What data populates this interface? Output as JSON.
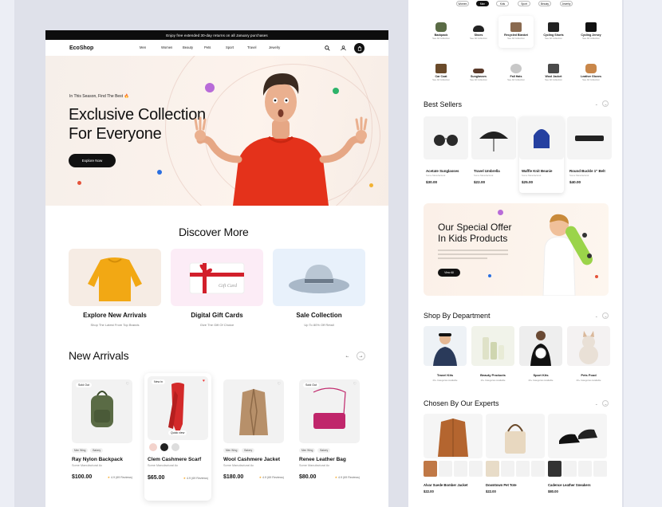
{
  "promo_text": "Enjoy free extended 30-day returns on all January purchases",
  "logo": "EcoShop",
  "nav": [
    "Men",
    "Women",
    "Beauty",
    "Pets",
    "Sport",
    "Travel",
    "Jewelry"
  ],
  "hero": {
    "eyebrow": "In This Season, Find The Best 🔥",
    "title_line1": "Exclusive Collection",
    "title_line2": "For Everyone",
    "button": "Explore Now"
  },
  "discover": {
    "title": "Discover More",
    "items": [
      {
        "title": "Explore New Arrivals",
        "subtitle": "Shop The Latest From Top Brands"
      },
      {
        "title": "Digital Gift Cards",
        "subtitle": "Give The Gift Of Choice",
        "card_text": "Gift Card"
      },
      {
        "title": "Sale Collection",
        "subtitle": "Up To 80% Off Retail"
      }
    ]
  },
  "new_arrivals": {
    "title": "New Arrivals",
    "products": [
      {
        "badge": "Sold Out",
        "tags": [
          "Men Wing",
          "Bakery"
        ],
        "name": "Ray Nylon Backpack",
        "brand": "Some Manufactural Ac",
        "price": "$100.00",
        "rating": "4.9 (69 Reviews)",
        "accent": "#5a6b45"
      },
      {
        "badge": "New in",
        "tags": [
          "Men Wing",
          "Bakery"
        ],
        "name": "Clem Cashmere Scarf",
        "brand": "Some Manufactural Ac",
        "price": "$65.00",
        "rating": "4.9 (69 Reviews)",
        "accent": "#d32a2a",
        "quick": "Quick view"
      },
      {
        "badge": "",
        "tags": [
          "Men Wing",
          "Bakery"
        ],
        "name": "Wool Cashmere Jacket",
        "brand": "Some Manufactural Ac",
        "price": "$180.00",
        "rating": "4.9 (69 Reviews)",
        "accent": "#b7906a"
      },
      {
        "badge": "Sold Out",
        "tags": [
          "Men Wing",
          "Bakery"
        ],
        "name": "Renee Leather Bag",
        "brand": "Some Manufactural Ac",
        "price": "$80.00",
        "rating": "4.9 (69 Reviews)",
        "accent": "#c0266b"
      }
    ]
  },
  "right": {
    "pills": [
      "Women",
      "Man",
      "Kids",
      "Sport",
      "Beauty",
      "Jewelry"
    ],
    "categories_row1": [
      {
        "name": "Backpack",
        "count": "See All Collection"
      },
      {
        "name": "Shoes",
        "count": "See All Collection"
      },
      {
        "name": "Recycled Blanket",
        "count": "See All Collection"
      },
      {
        "name": "Cycling Shorts",
        "count": "See All Collection"
      },
      {
        "name": "Cycling Jersey",
        "count": "See All Collection"
      }
    ],
    "categories_row2": [
      {
        "name": "Car Coat",
        "count": "See All Collection"
      },
      {
        "name": "Sunglasses",
        "count": "See All Collection"
      },
      {
        "name": "Fall Hats",
        "count": "See All Collection"
      },
      {
        "name": "Wool Jacket",
        "count": "See All Collection"
      },
      {
        "name": "Leather Gloves",
        "count": "See All Collection"
      }
    ],
    "best_sellers": {
      "title": "Best Sellers",
      "items": [
        {
          "name": "Acetate Sunglasses",
          "sub": "Some Manufactural",
          "price": "$30.00"
        },
        {
          "name": "Travel Umbrella",
          "sub": "Some Manufactural",
          "price": "$22.00"
        },
        {
          "name": "Waffle Knit Beanie",
          "sub": "Some Manufactural",
          "price": "$25.00"
        },
        {
          "name": "Round Buckle 1\" Belt",
          "sub": "Some Manufactural",
          "price": "$40.00"
        }
      ]
    },
    "offer": {
      "title_line1": "Our Special Offer",
      "title_line2": "In Kids Products",
      "button": "View All"
    },
    "departments": {
      "title": "Shop By Department",
      "items": [
        {
          "name": "Travel Kits",
          "count": "20+ Categories Available"
        },
        {
          "name": "Beauty Products",
          "count": "10+ Categories Available"
        },
        {
          "name": "Sport Kits",
          "count": "20+ Categories Available"
        },
        {
          "name": "Pets Food",
          "count": "20+ Categories Available"
        }
      ]
    },
    "experts": {
      "title": "Chosen By Our Experts",
      "items": [
        {
          "name": "Alvar Suede Bomber Jacket",
          "price": "$22.00"
        },
        {
          "name": "Downtown Pet Tote",
          "price": "$22.00"
        },
        {
          "name": "Cadence Leather Sneakers",
          "price": "$80.00"
        }
      ]
    }
  }
}
